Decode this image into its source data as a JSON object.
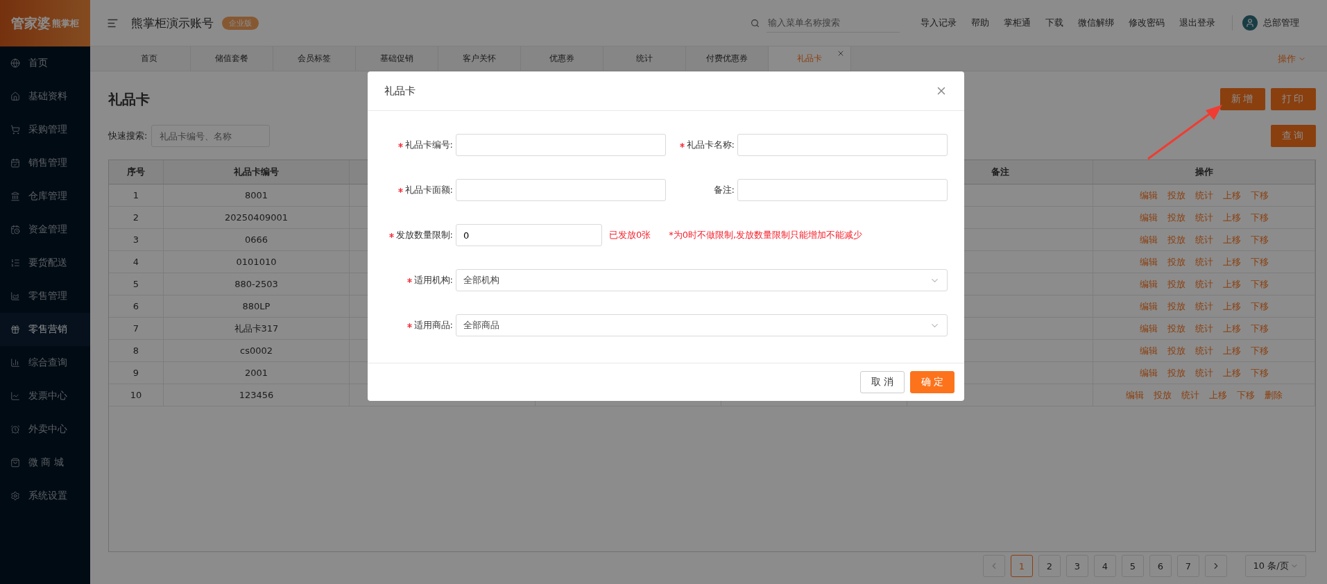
{
  "logo": {
    "brand": "管家婆",
    "sub": "熊掌柜"
  },
  "header": {
    "account": "熊掌柜演示账号",
    "edition": "企业版",
    "search": {
      "placeholder": "输入菜单名称搜索"
    },
    "links": [
      "导入记录",
      "帮助",
      "掌柜通",
      "下载",
      "微信解绑",
      "修改密码",
      "退出登录"
    ],
    "user": "总部管理"
  },
  "sidebar": {
    "items": [
      {
        "label": "首页",
        "selected": false
      },
      {
        "label": "基础资料",
        "selected": false
      },
      {
        "label": "采购管理",
        "selected": false
      },
      {
        "label": "销售管理",
        "selected": false
      },
      {
        "label": "仓库管理",
        "selected": false
      },
      {
        "label": "资金管理",
        "selected": false
      },
      {
        "label": "要货配送",
        "selected": false
      },
      {
        "label": "零售管理",
        "selected": false
      },
      {
        "label": "零售营销",
        "selected": true
      },
      {
        "label": "综合查询",
        "selected": false
      },
      {
        "label": "发票中心",
        "selected": false
      },
      {
        "label": "外卖中心",
        "selected": false
      },
      {
        "label": "微 商 城",
        "selected": false
      },
      {
        "label": "系统设置",
        "selected": false
      }
    ]
  },
  "tabs": [
    {
      "label": "首页",
      "selected": false
    },
    {
      "label": "储值套餐",
      "selected": false
    },
    {
      "label": "会员标签",
      "selected": false
    },
    {
      "label": "基础促销",
      "selected": false
    },
    {
      "label": "客户关怀",
      "selected": false
    },
    {
      "label": "优惠券",
      "selected": false
    },
    {
      "label": "统计",
      "selected": false
    },
    {
      "label": "付费优惠券",
      "selected": false
    },
    {
      "label": "礼品卡",
      "selected": true
    }
  ],
  "tabs_menu": "操作",
  "page": {
    "title": "礼品卡",
    "buttons": [
      "新增",
      "打印"
    ],
    "search": {
      "label": "快速搜索:",
      "placeholder": "礼品卡编号、名称",
      "button": "查询"
    }
  },
  "table": {
    "columns": [
      "序号",
      "礼品卡编号",
      "备注",
      "操作"
    ],
    "rows": [
      {
        "no": "1",
        "code": "8001",
        "actions": [
          "编辑",
          "投放",
          "统计",
          "上移",
          "下移"
        ]
      },
      {
        "no": "2",
        "code": "20250409001",
        "actions": [
          "编辑",
          "投放",
          "统计",
          "上移",
          "下移"
        ]
      },
      {
        "no": "3",
        "code": "0666",
        "actions": [
          "编辑",
          "投放",
          "统计",
          "上移",
          "下移"
        ]
      },
      {
        "no": "4",
        "code": "0101010",
        "actions": [
          "编辑",
          "投放",
          "统计",
          "上移",
          "下移"
        ]
      },
      {
        "no": "5",
        "code": "880-2503",
        "actions": [
          "编辑",
          "投放",
          "统计",
          "上移",
          "下移"
        ]
      },
      {
        "no": "6",
        "code": "880LP",
        "actions": [
          "编辑",
          "投放",
          "统计",
          "上移",
          "下移"
        ]
      },
      {
        "no": "7",
        "code": "礼品卡317",
        "actions": [
          "编辑",
          "投放",
          "统计",
          "上移",
          "下移"
        ]
      },
      {
        "no": "8",
        "code": "cs0002",
        "actions": [
          "编辑",
          "投放",
          "统计",
          "上移",
          "下移"
        ]
      },
      {
        "no": "9",
        "code": "2001",
        "actions": [
          "编辑",
          "投放",
          "统计",
          "上移",
          "下移"
        ]
      },
      {
        "no": "10",
        "code": "123456",
        "actions": [
          "编辑",
          "投放",
          "统计",
          "上移",
          "下移",
          "删除"
        ]
      }
    ]
  },
  "pagination": {
    "pages": [
      {
        "label": "1",
        "selected": true
      },
      {
        "label": "2",
        "selected": false
      },
      {
        "label": "3",
        "selected": false
      },
      {
        "label": "4",
        "selected": false
      },
      {
        "label": "5",
        "selected": false
      },
      {
        "label": "6",
        "selected": false
      },
      {
        "label": "7",
        "selected": false
      }
    ],
    "page_size": "10 条/页"
  },
  "dialog": {
    "title": "礼品卡",
    "fields": [
      {
        "kind": "input",
        "label": "礼品卡编号:",
        "required": true
      },
      {
        "kind": "input",
        "label": "礼品卡名称:",
        "required": true
      },
      {
        "kind": "input",
        "label": "礼品卡面额:",
        "required": true
      },
      {
        "kind": "input",
        "label": "备注:",
        "required": false
      },
      {
        "kind": "limit",
        "label": "发放数量限制:",
        "required": true,
        "value": "0",
        "issued": "已发放0张",
        "hint": "*为0时不做限制,发放数量限制只能增加不能减少"
      },
      {
        "kind": "select",
        "label": "适用机构:",
        "required": true,
        "value": "全部机构"
      },
      {
        "kind": "select",
        "label": "适用商品:",
        "required": true,
        "value": "全部商品"
      }
    ],
    "buttons": [
      {
        "label": "取 消",
        "kind": "secondary"
      },
      {
        "label": "确 定",
        "kind": "primary"
      }
    ]
  }
}
